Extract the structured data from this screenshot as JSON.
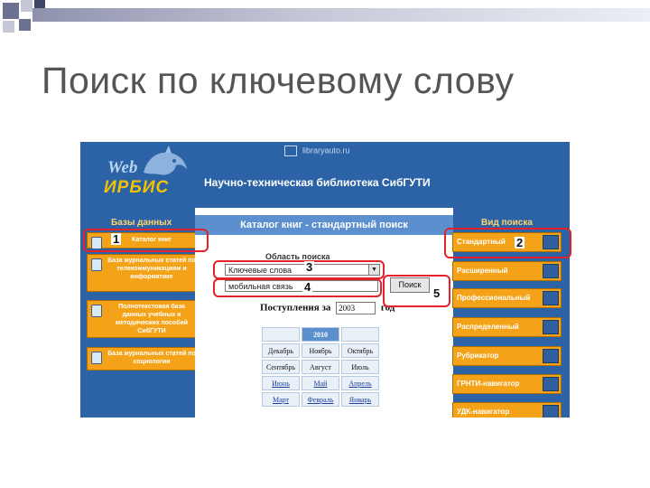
{
  "slide_title": "Поиск по ключевому слову",
  "site": {
    "url": "libraryauto.ru",
    "lib_title": "Научно-техническая библиотека СибГУТИ",
    "logo_web": "Web",
    "logo_irbis": "ИРБИС"
  },
  "left": {
    "heading": "Базы данных",
    "items": [
      "Каталог книг",
      "База журнальных статей по телекоммуникациям и информатике",
      "Полнотекстовая база данных учебных и методических пособий СибГУТИ",
      "База журнальных статей по социологии"
    ]
  },
  "center": {
    "heading": "Каталог книг - стандартный поиск",
    "area_label": "Область поиска",
    "select_value": "Ключевые слова",
    "query_value": "мобильная связь",
    "search_button": "Поиск",
    "postup_prefix": "Поступления за",
    "postup_year": "2003",
    "postup_suffix": "год",
    "table_year": "2010",
    "months": [
      [
        "Декабрь",
        "Ноябрь",
        "Октябрь"
      ],
      [
        "Сентябрь",
        "Август",
        "Июль"
      ],
      [
        "Июнь",
        "Май",
        "Апрель"
      ],
      [
        "Март",
        "Февраль",
        "Январь"
      ]
    ]
  },
  "right": {
    "heading": "Вид поиска",
    "items": [
      "Стандартный",
      "Расширенный",
      "Профессиональный",
      "Распределенный",
      "Рубрикатор",
      "ГРНТИ-навигатор",
      "УДК-навигатор"
    ]
  },
  "callouts": [
    "1",
    "2",
    "3",
    "4",
    "5"
  ],
  "colors": {
    "accent_blue": "#2b63a6",
    "orange": "#f4a218",
    "highlight_red": "#e3222b",
    "title_gray": "#555555"
  },
  "icons": [
    "database-icon",
    "magnifier-icon",
    "lynx-logo-icon"
  ]
}
